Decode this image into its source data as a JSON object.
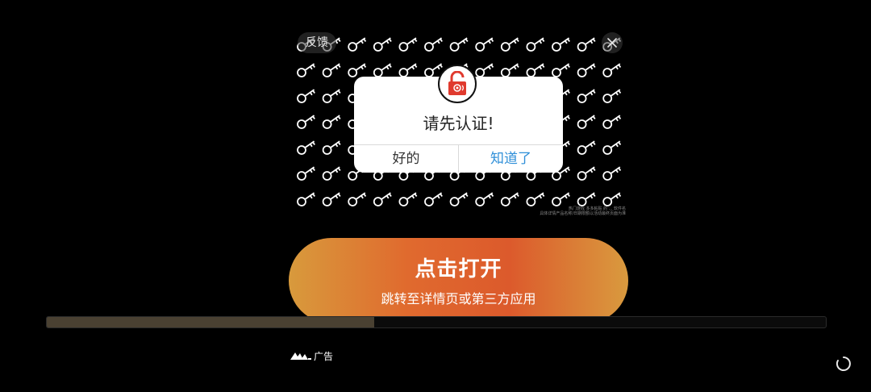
{
  "ad": {
    "feedback_label": "反馈",
    "fine_print_line1": "热门游戏 多多粘贴 的 ... 软件名",
    "fine_print_line2": "具体详情产品名称/日期限额以活动最终页面为准",
    "badge_label": "广告"
  },
  "dialog": {
    "title": "请先认证!",
    "ok_label": "好的",
    "know_label": "知道了"
  },
  "cta": {
    "title": "点击打开",
    "subtitle": "跳转至详情页或第三方应用"
  },
  "progress": {
    "fraction": 0.42
  },
  "colors": {
    "cta_orange": "#e06a2e",
    "cta_gold": "#d89a3c",
    "dialog_link_blue": "#2f8fd8",
    "lock_red": "#e03a2e"
  },
  "icons": {
    "key": "key-icon",
    "close": "close-icon",
    "lock": "lock-icon",
    "ad_logo": "ad-logo-icon",
    "spinner": "loading-spinner-icon"
  }
}
